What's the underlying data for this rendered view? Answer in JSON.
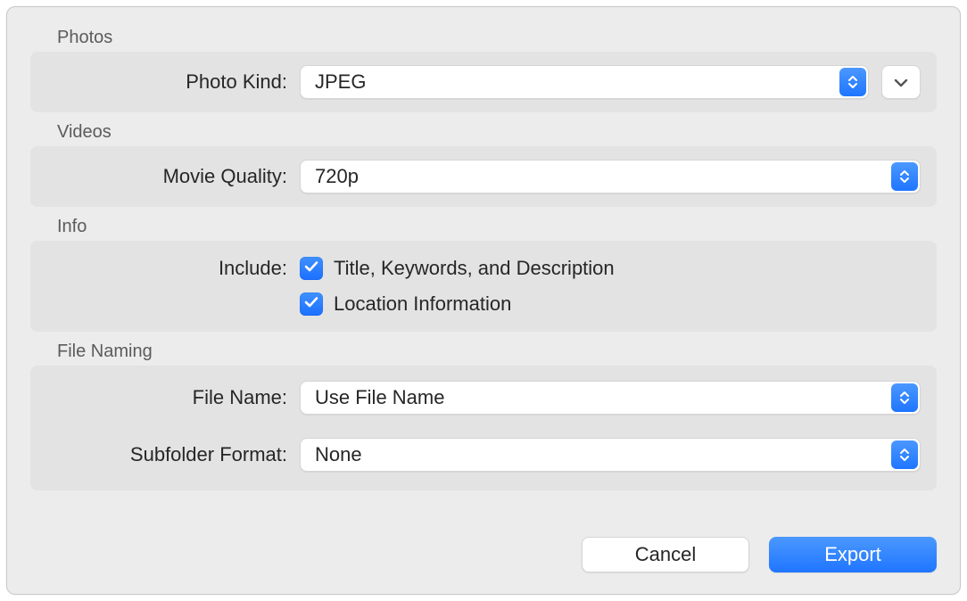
{
  "sections": {
    "photos": {
      "title": "Photos",
      "photoKindLabel": "Photo Kind:",
      "photoKindValue": "JPEG"
    },
    "videos": {
      "title": "Videos",
      "movieQualityLabel": "Movie Quality:",
      "movieQualityValue": "720p"
    },
    "info": {
      "title": "Info",
      "includeLabel": "Include:",
      "opt1": "Title, Keywords, and Description",
      "opt1Checked": true,
      "opt2": "Location Information",
      "opt2Checked": true
    },
    "fileNaming": {
      "title": "File Naming",
      "fileNameLabel": "File Name:",
      "fileNameValue": "Use File Name",
      "subfolderLabel": "Subfolder Format:",
      "subfolderValue": "None"
    }
  },
  "buttons": {
    "cancel": "Cancel",
    "export": "Export"
  }
}
